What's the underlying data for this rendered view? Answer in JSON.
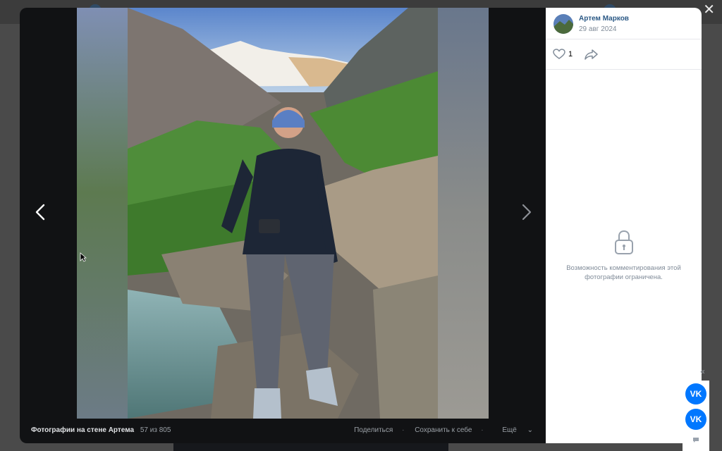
{
  "viewer": {
    "album_label": "Фотографии на стене Артема",
    "counter": "57 из 805",
    "actions": {
      "share": "Поделиться",
      "save": "Сохранить к себе",
      "more": "Ещё"
    }
  },
  "panel": {
    "author_name": "Артем Марков",
    "date": "29 авг 2024",
    "likes": "1",
    "comments_restricted": "Возможность комментирования этой фотографии ограничена."
  },
  "widgets": {
    "vk_logo_1": "VK",
    "vk_logo_2": "VK"
  },
  "colors": {
    "accent": "#0077ff",
    "link": "#2a5885",
    "muted": "#818c99"
  },
  "icons": [
    "close-icon",
    "chevron-left-icon",
    "chevron-right-icon",
    "heart-icon",
    "share-arrow-icon",
    "lock-icon",
    "chevron-down-icon",
    "chat-icon",
    "double-chevron-left-icon"
  ]
}
